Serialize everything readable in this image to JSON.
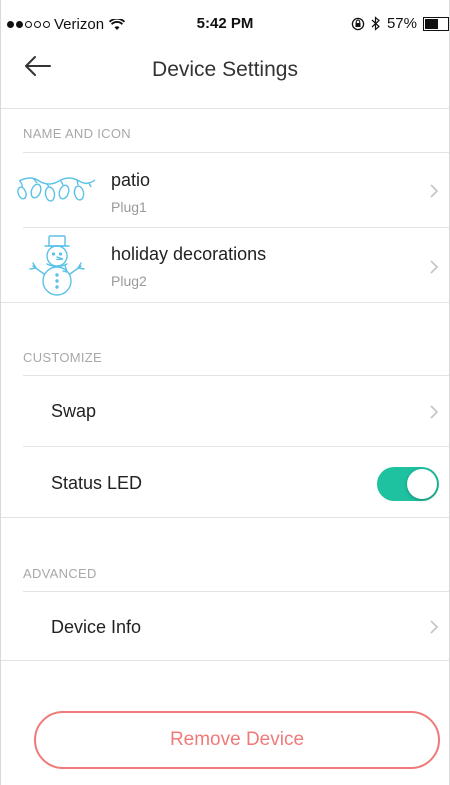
{
  "status_bar": {
    "carrier": "Verizon",
    "time": "5:42 PM",
    "battery": "57%",
    "battery_level": 0.57,
    "signal_bars_filled": 2,
    "signal_bars_total": 5
  },
  "header": {
    "title": "Device Settings"
  },
  "sections": {
    "name_and_icon": "NAME AND ICON",
    "customize": "CUSTOMIZE",
    "advanced": "ADVANCED"
  },
  "devices": [
    {
      "name": "patio",
      "plug": "Plug1",
      "icon": "string-lights-icon"
    },
    {
      "name": "holiday decorations",
      "plug": "Plug2",
      "icon": "snowman-icon"
    }
  ],
  "customize": {
    "swap_label": "Swap",
    "status_led_label": "Status LED",
    "status_led_on": true
  },
  "advanced": {
    "device_info_label": "Device Info"
  },
  "remove_label": "Remove Device",
  "colors": {
    "accent": "#1ec1a0",
    "danger": "#f07a7a",
    "icon_blue": "#5bc2e7"
  }
}
